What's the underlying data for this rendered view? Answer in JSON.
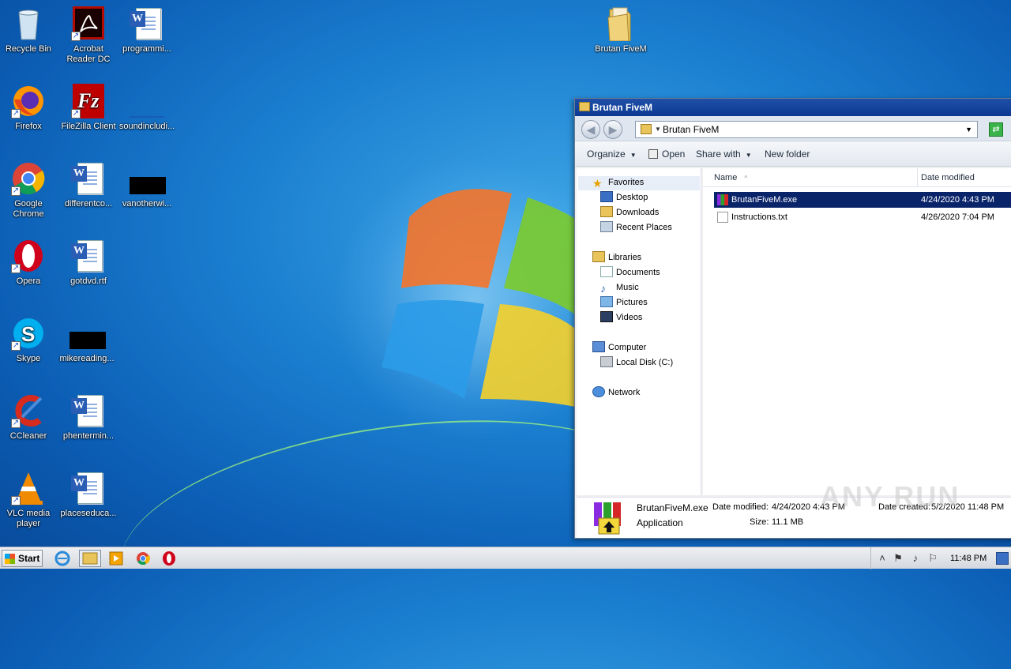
{
  "desktop": {
    "icons": [
      {
        "label": "Recycle Bin",
        "icon": "recycle-bin-icon"
      },
      {
        "label": "Acrobat Reader DC",
        "icon": "acrobat-icon"
      },
      {
        "label": "programmi...",
        "icon": "word-doc-icon"
      },
      {
        "label": "Brutan FiveM",
        "icon": "folder-icon"
      },
      {
        "label": "Firefox",
        "icon": "firefox-icon"
      },
      {
        "label": "FileZilla Client",
        "icon": "filezilla-icon"
      },
      {
        "label": "soundincludi...",
        "icon": "blank-file-icon"
      },
      {
        "label": "Google Chrome",
        "icon": "chrome-icon"
      },
      {
        "label": "differentco...",
        "icon": "word-doc-icon"
      },
      {
        "label": "vanotherwi...",
        "icon": "black-thumbnail-icon"
      },
      {
        "label": "Opera",
        "icon": "opera-icon"
      },
      {
        "label": "gotdvd.rtf",
        "icon": "word-doc-icon"
      },
      {
        "label": "Skype",
        "icon": "skype-icon"
      },
      {
        "label": "mikereading...",
        "icon": "black-thumbnail-icon"
      },
      {
        "label": "CCleaner",
        "icon": "ccleaner-icon"
      },
      {
        "label": "phentermin...",
        "icon": "word-doc-icon"
      },
      {
        "label": "VLC media player",
        "icon": "vlc-icon"
      },
      {
        "label": "placeseduca...",
        "icon": "word-doc-icon"
      }
    ]
  },
  "explorer": {
    "title": "Brutan FiveM",
    "address": "Brutan FiveM",
    "toolbar": {
      "organize": "Organize",
      "open": "Open",
      "share_with": "Share with",
      "new_folder": "New folder"
    },
    "nav": {
      "favorites": "Favorites",
      "desktop": "Desktop",
      "downloads": "Downloads",
      "recent": "Recent Places",
      "libraries": "Libraries",
      "documents": "Documents",
      "music": "Music",
      "pictures": "Pictures",
      "videos": "Videos",
      "computer": "Computer",
      "local_disk": "Local Disk (C:)",
      "network": "Network"
    },
    "columns": {
      "name": "Name",
      "date_modified": "Date modified"
    },
    "files": [
      {
        "name": "BrutanFiveM.exe",
        "date": "4/24/2020 4:43 PM",
        "selected": true
      },
      {
        "name": "Instructions.txt",
        "date": "4/26/2020 7:04 PM",
        "selected": false
      }
    ],
    "details": {
      "filename": "BrutanFiveM.exe",
      "type": "Application",
      "date_modified_label": "Date modified:",
      "date_modified": "4/24/2020 4:43 PM",
      "size_label": "Size:",
      "size": "11.1 MB",
      "date_created_label": "Date created:",
      "date_created": "5/2/2020 11:48 PM"
    }
  },
  "watermark": "ANY RUN",
  "taskbar": {
    "start": "Start",
    "clock": "11:48 PM"
  }
}
